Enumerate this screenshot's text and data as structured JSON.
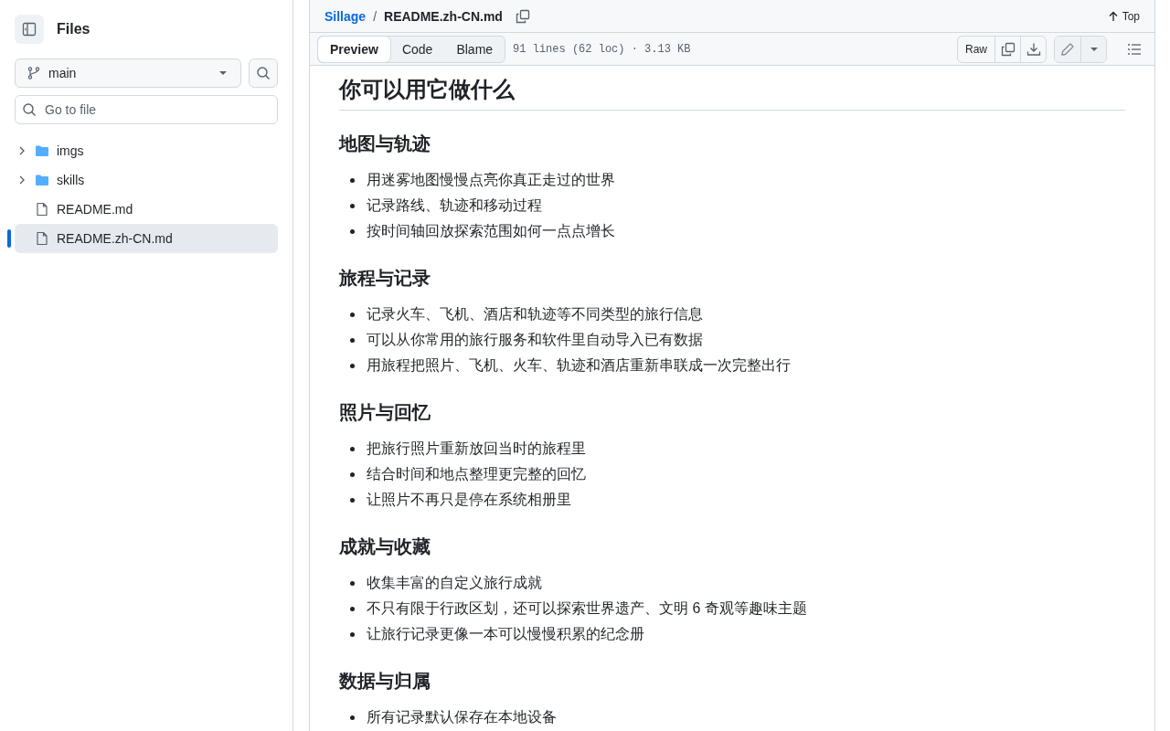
{
  "sidebar": {
    "title": "Files",
    "branch": "main",
    "search": {
      "placeholder": "Go to file"
    },
    "items": [
      {
        "kind": "folder",
        "name": "imgs",
        "expanded": false,
        "selected": false
      },
      {
        "kind": "folder",
        "name": "skills",
        "expanded": false,
        "selected": false
      },
      {
        "kind": "file",
        "name": "README.md",
        "selected": false
      },
      {
        "kind": "file",
        "name": "README.zh-CN.md",
        "selected": true
      }
    ]
  },
  "breadcrumb": {
    "repo": "Sillage",
    "separator": "/",
    "file": "README.zh-CN.md",
    "top": "Top"
  },
  "toolbar": {
    "tabs": [
      {
        "label": "Preview",
        "selected": true
      },
      {
        "label": "Code",
        "selected": false
      },
      {
        "label": "Blame",
        "selected": false
      }
    ],
    "info": "91 lines (62 loc) · 3.13 KB",
    "raw": "Raw"
  },
  "document": {
    "title": "你可以用它做什么",
    "sections": [
      {
        "heading": "地图与轨迹",
        "items": [
          "用迷雾地图慢慢点亮你真正走过的世界",
          "记录路线、轨迹和移动过程",
          "按时间轴回放探索范围如何一点点增长"
        ]
      },
      {
        "heading": "旅程与记录",
        "items": [
          "记录火车、飞机、酒店和轨迹等不同类型的旅行信息",
          "可以从你常用的旅行服务和软件里自动导入已有数据",
          "用旅程把照片、飞机、火车、轨迹和酒店重新串联成一次完整出行"
        ]
      },
      {
        "heading": "照片与回忆",
        "items": [
          "把旅行照片重新放回当时的旅程里",
          "结合时间和地点整理更完整的回忆",
          "让照片不再只是停在系统相册里"
        ]
      },
      {
        "heading": "成就与收藏",
        "items": [
          "收集丰富的自定义旅行成就",
          "不只有限于行政区划，还可以探索世界遗产、文明 6 奇观等趣味主题",
          "让旅行记录更像一本可以慢慢积累的纪念册"
        ]
      },
      {
        "heading": "数据与归属",
        "items": [
          "所有记录默认保存在本地设备"
        ]
      }
    ]
  }
}
